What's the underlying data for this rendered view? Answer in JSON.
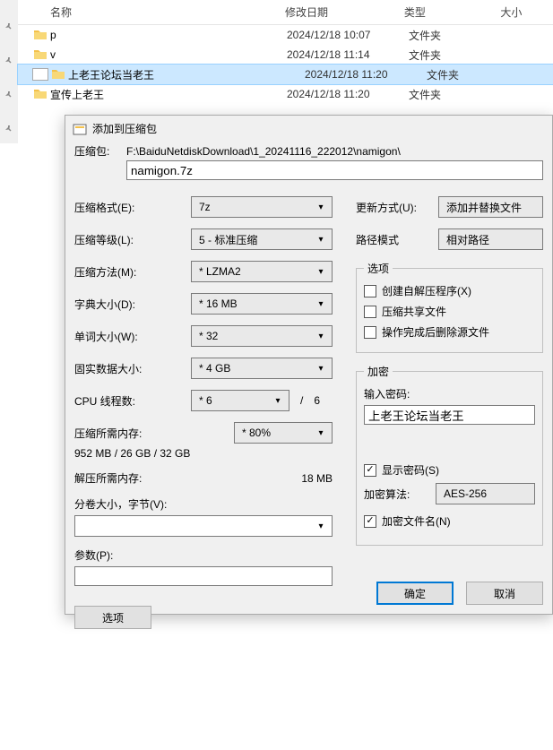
{
  "file_list": {
    "headers": {
      "name": "名称",
      "date": "修改日期",
      "type": "类型",
      "size": "大小"
    },
    "rows": [
      {
        "icon": "folder",
        "name": "p",
        "date": "2024/12/18 10:07",
        "type": "文件夹",
        "selected": false
      },
      {
        "icon": "folder",
        "name": "v",
        "date": "2024/12/18 11:14",
        "type": "文件夹",
        "selected": false
      },
      {
        "icon": "folder",
        "name": "上老王论坛当老王",
        "date": "2024/12/18 11:20",
        "type": "文件夹",
        "selected": true
      },
      {
        "icon": "folder",
        "name": "宣传上老王",
        "date": "2024/12/18 11:20",
        "type": "文件夹",
        "selected": false
      }
    ]
  },
  "dialog": {
    "title": "添加到压缩包",
    "archive_label": "压缩包:",
    "path": "F:\\BaiduNetdiskDownload\\1_20241116_222012\\namigon\\",
    "file_name": "namigon.7z",
    "left": {
      "format_label": "压缩格式(E):",
      "format_value": "7z",
      "level_label": "压缩等级(L):",
      "level_value": "5 - 标准压缩",
      "method_label": "压缩方法(M):",
      "method_value": "* LZMA2",
      "dict_label": "字典大小(D):",
      "dict_value": "* 16 MB",
      "word_label": "单词大小(W):",
      "word_value": "* 32",
      "solid_label": "固实数据大小:",
      "solid_value": "* 4 GB",
      "cpu_label": "CPU 线程数:",
      "cpu_value": "* 6",
      "cpu_total": "6",
      "compmem_label": "压缩所需内存:",
      "compmem_detail": "952 MB / 26 GB / 32 GB",
      "compmem_pct": "* 80%",
      "decompmem_label": "解压所需内存:",
      "decompmem_value": "18 MB",
      "volume_label": "分卷大小，字节(V):",
      "params_label": "参数(P):",
      "options_button": "选项"
    },
    "right": {
      "update_label": "更新方式(U):",
      "update_value": "添加并替换文件",
      "paths_label": "路径模式",
      "paths_value": "相对路径",
      "options_legend": "选项",
      "opt_sfx": "创建自解压程序(X)",
      "opt_share": "压缩共享文件",
      "opt_delete": "操作完成后删除源文件",
      "encrypt_legend": "加密",
      "password_label": "输入密码:",
      "password_value": "上老王论坛当老王",
      "show_pwd": "显示密码(S)",
      "enc_method_label": "加密算法:",
      "enc_method_value": "AES-256",
      "enc_names": "加密文件名(N)"
    },
    "buttons": {
      "ok": "确定",
      "cancel": "取消"
    }
  }
}
